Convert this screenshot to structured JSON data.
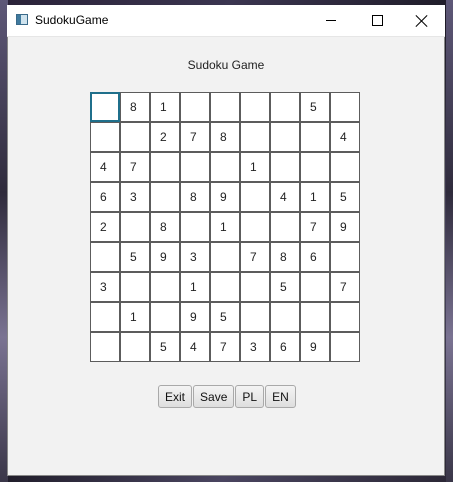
{
  "window": {
    "title": "SudokuGame"
  },
  "heading": "Sudoku Game",
  "board": [
    [
      "",
      "8",
      "1",
      "",
      "",
      "",
      "",
      "5",
      ""
    ],
    [
      "",
      "",
      "2",
      "7",
      "8",
      "",
      "",
      "",
      "4"
    ],
    [
      "4",
      "7",
      "",
      "",
      "",
      "1",
      "",
      "",
      ""
    ],
    [
      "6",
      "3",
      "",
      "8",
      "9",
      "",
      "4",
      "1",
      "5"
    ],
    [
      "2",
      "",
      "8",
      "",
      "1",
      "",
      "",
      "7",
      "9"
    ],
    [
      "",
      "5",
      "9",
      "3",
      "",
      "7",
      "8",
      "6",
      ""
    ],
    [
      "3",
      "",
      "",
      "1",
      "",
      "",
      "5",
      "",
      "7"
    ],
    [
      "",
      "1",
      "",
      "9",
      "5",
      "",
      "",
      "",
      ""
    ],
    [
      "",
      "",
      "5",
      "4",
      "7",
      "3",
      "6",
      "9",
      ""
    ]
  ],
  "focused_cell": {
    "row": 0,
    "col": 0
  },
  "buttons": {
    "exit": "Exit",
    "save": "Save",
    "pl": "PL",
    "en": "EN"
  },
  "colors": {
    "window_bg": "#f2f2f2",
    "cell_border": "#5c5c5c",
    "focus_border": "#1f6f8b"
  }
}
